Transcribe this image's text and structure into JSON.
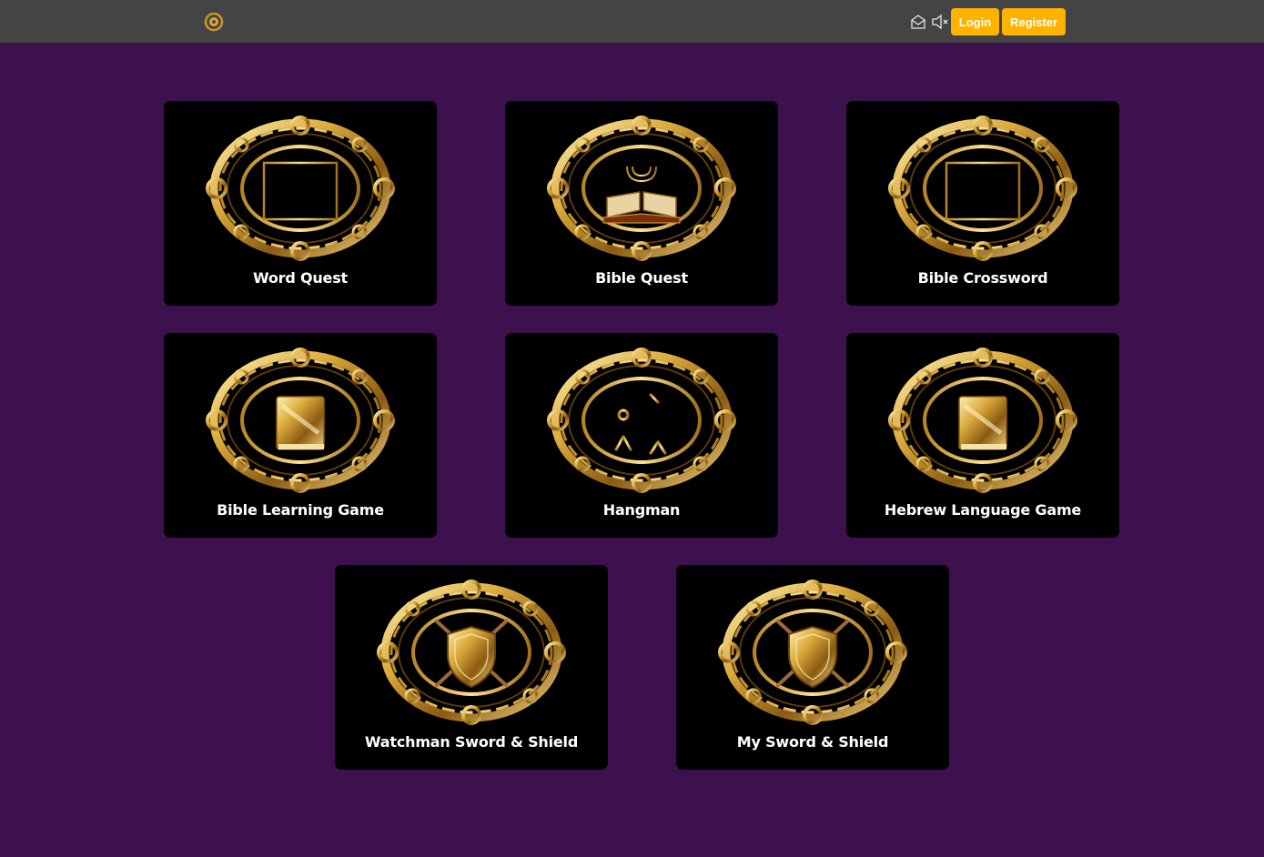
{
  "header": {
    "logo_icon": "golden-emblem-icon",
    "mail_icon": "envelope-open-icon",
    "sound_icon": "speaker-muted-icon",
    "login_label": "Login",
    "register_label": "Register",
    "accent_color": "#ffb300",
    "bar_color": "#444444"
  },
  "page": {
    "background_color": "#3d114e",
    "card_color": "#000000"
  },
  "games": [
    {
      "title": "Word Quest",
      "icon": "letter-grid-icon"
    },
    {
      "title": "Bible Quest",
      "icon": "open-bible-menorah-icon"
    },
    {
      "title": "Bible Crossword",
      "icon": "crossword-grid-icon"
    },
    {
      "title": "Bible Learning Game",
      "icon": "golden-book-icon"
    },
    {
      "title": "Hangman",
      "icon": "gallows-icon"
    },
    {
      "title": "Hebrew Language Game",
      "icon": "golden-book-icon"
    },
    {
      "title": "Watchman Sword & Shield",
      "icon": "sword-shield-icon"
    },
    {
      "title": "My Sword & Shield",
      "icon": "sword-shield-icon"
    }
  ]
}
